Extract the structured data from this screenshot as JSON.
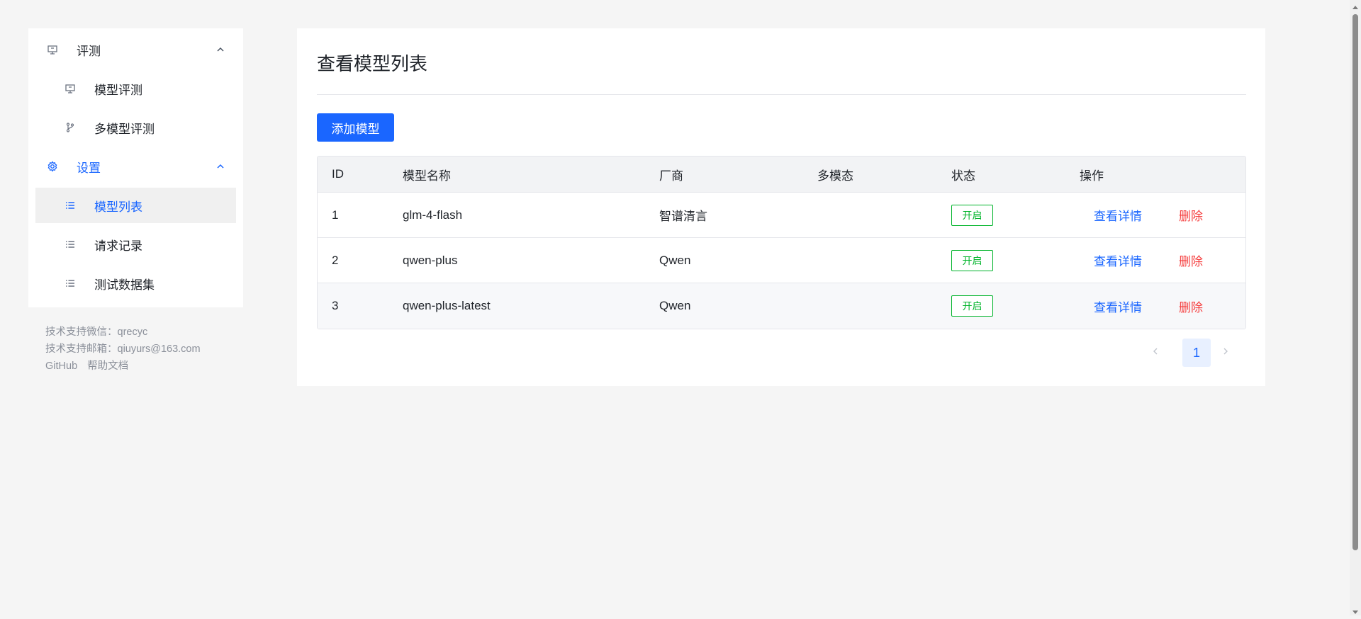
{
  "sidebar": {
    "groups": [
      {
        "label": "评测",
        "icon": "monitor-icon",
        "items": [
          {
            "label": "模型评测",
            "icon": "monitor-icon"
          },
          {
            "label": "多模型评测",
            "icon": "branch-icon"
          }
        ]
      },
      {
        "label": "设置",
        "icon": "gear-icon",
        "items": [
          {
            "label": "模型列表",
            "icon": "list-icon"
          },
          {
            "label": "请求记录",
            "icon": "list-icon"
          },
          {
            "label": "测试数据集",
            "icon": "list-icon"
          }
        ]
      }
    ],
    "footer": {
      "wechat_label": "技术支持微信：",
      "wechat_value": "qrecyc",
      "email_label": "技术支持邮箱：",
      "email_value": "qiuyurs@163.com",
      "github_link": "GitHub",
      "docs_link": "帮助文档"
    }
  },
  "main": {
    "title": "查看模型列表",
    "add_button": "添加模型",
    "table": {
      "columns": [
        "ID",
        "模型名称",
        "厂商",
        "多模态",
        "状态",
        "操作"
      ],
      "rows": [
        {
          "id": "1",
          "name": "glm-4-flash",
          "vendor": "智谱清言",
          "multimodal": "",
          "status": "开启",
          "view": "查看详情",
          "delete": "删除"
        },
        {
          "id": "2",
          "name": "qwen-plus",
          "vendor": "Qwen",
          "multimodal": "",
          "status": "开启",
          "view": "查看详情",
          "delete": "删除"
        },
        {
          "id": "3",
          "name": "qwen-plus-latest",
          "vendor": "Qwen",
          "multimodal": "",
          "status": "开启",
          "view": "查看详情",
          "delete": "删除"
        }
      ]
    },
    "pagination": {
      "current_page": "1"
    }
  },
  "colors": {
    "primary": "#1a66ff",
    "success": "#00b42a",
    "danger": "#f53f3f"
  }
}
